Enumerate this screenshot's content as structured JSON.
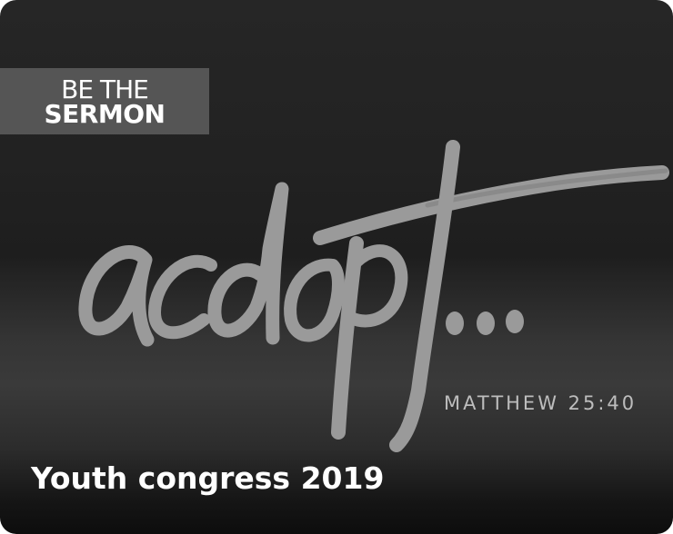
{
  "tile": {
    "tag_line1": "BE THE",
    "tag_line2": "SERMON",
    "artwork_word": "adopt...",
    "scripture_ref": "MATTHEW 25:40",
    "caption": "Youth congress 2019"
  },
  "colors": {
    "background": "#1f1f1f",
    "tag_background": "#555555",
    "brush_stroke": "#9a9a9a",
    "caption": "#ffffff"
  }
}
